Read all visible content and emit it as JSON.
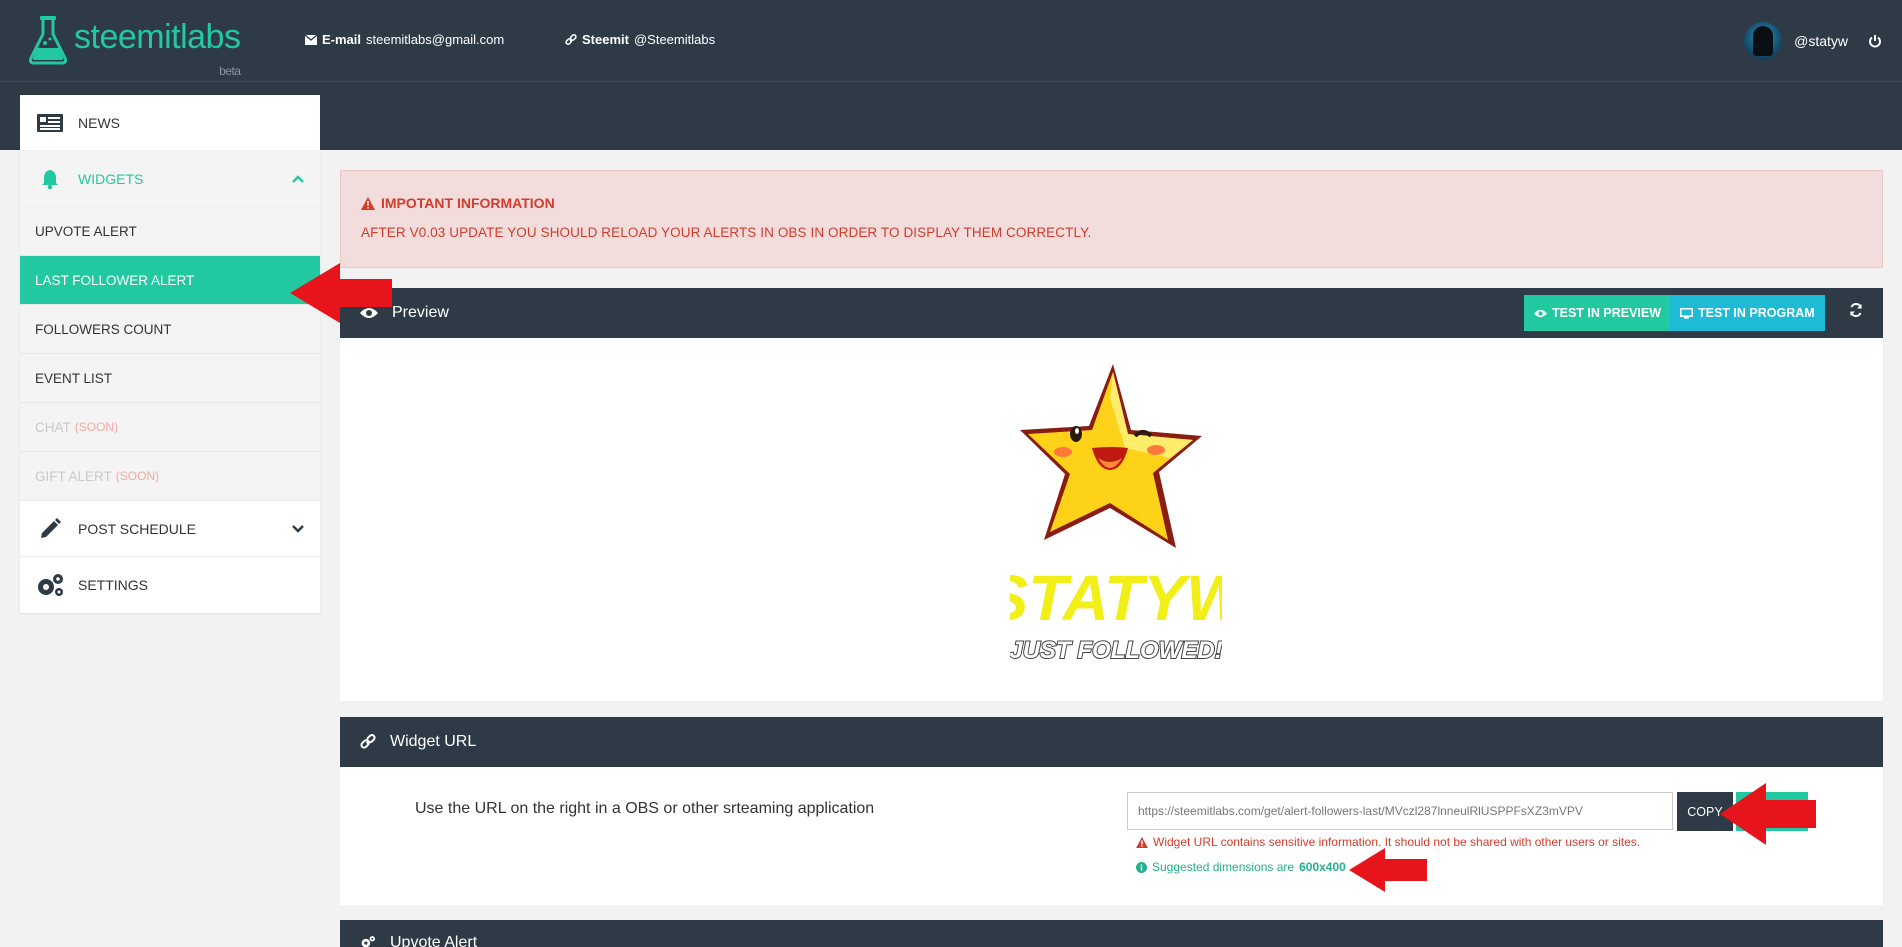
{
  "header": {
    "logo_text": "steemitlabs",
    "logo_badge": "beta",
    "email_label": "E-mail",
    "email_value": "steemitlabs@gmail.com",
    "steemit_label": "Steemit",
    "steemit_value": "@Steemitlabs",
    "username": "@statyw"
  },
  "sidebar": {
    "news": "NEWS",
    "widgets": "WIDGETS",
    "sub_items": [
      {
        "label": "UPVOTE ALERT"
      },
      {
        "label": "LAST FOLLOWER ALERT"
      },
      {
        "label": "FOLLOWERS COUNT"
      },
      {
        "label": "EVENT LIST"
      },
      {
        "label": "CHAT",
        "tag": "(SOON)"
      },
      {
        "label": "GIFT ALERT",
        "tag": "(SOON)"
      }
    ],
    "post_schedule": "POST SCHEDULE",
    "settings": "SETTINGS"
  },
  "alert": {
    "title": "IMPOTANT INFORMATION",
    "body": "AFTER V0.03 UPDATE YOU SHOULD RELOAD YOUR ALERTS IN OBS IN ORDER TO DISPLAY THEM CORRECTLY."
  },
  "preview": {
    "title": "Preview",
    "test_preview": "TEST IN PREVIEW",
    "test_program": "TEST IN PROGRAM",
    "alert_name": "STATYW",
    "alert_text": "JUST FOLLOWED!"
  },
  "widget_url": {
    "title": "Widget URL",
    "description": "Use the URL on the right in a OBS or other srteaming application",
    "url": "https://steemitlabs.com/get/alert-followers-last/MVczl287lnneulRlUSPPFsXZ3mVPV",
    "copy": "COPY",
    "warning": "Widget URL contains sensitive information. It should not be shared with other users or sites.",
    "info_prefix": "Suggested dimensions are",
    "info_dims": "600x400"
  },
  "upvote_alert": {
    "title": "Upvote Alert"
  },
  "colors": {
    "accent": "#22c9a0",
    "dark": "#2e3b47",
    "danger": "#d23c2c",
    "annotation_arrow": "#e8141c"
  }
}
